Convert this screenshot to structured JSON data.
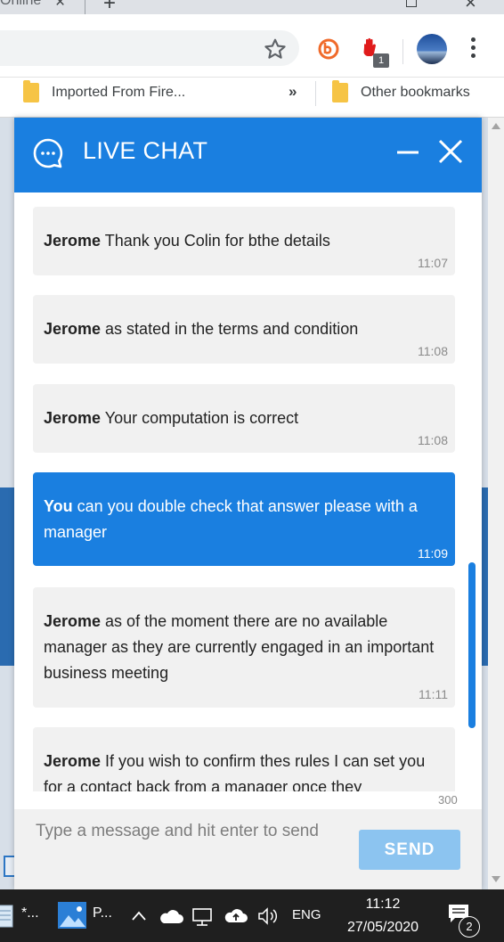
{
  "browser": {
    "tab_title": "Online",
    "tab_close": "×",
    "new_tab": "+",
    "extension_badge": "1",
    "bookmarks": [
      {
        "label": "Imported From Fire..."
      },
      {
        "label": "Other bookmarks"
      }
    ],
    "bookmarks_overflow": "»"
  },
  "chat": {
    "title": "LIVE CHAT",
    "messages": [
      {
        "sender": "Jerome",
        "text": " Thank you Colin for bthe details",
        "time": "11:07",
        "mine": false
      },
      {
        "sender": "Jerome",
        "text": " as stated in the terms and condition",
        "time": "11:08",
        "mine": false
      },
      {
        "sender": "Jerome",
        "text": " Your computation is correct",
        "time": "11:08",
        "mine": false
      },
      {
        "sender": "You",
        "text": " can you double check that answer please with a manager",
        "time": "11:09",
        "mine": true
      },
      {
        "sender": "Jerome",
        "text": " as of the moment there are no available manager as they are currently engaged in an important business meeting",
        "time": "11:11",
        "mine": false
      },
      {
        "sender": "Jerome",
        "text": " If you wish to confirm thes rules I can set you for a contact back from a manager once they",
        "time": "",
        "mine": false
      }
    ],
    "char_counter": "300",
    "input_placeholder": "Type a message and hit enter to send",
    "send_label": "SEND"
  },
  "taskbar": {
    "apps": [
      {
        "label": "*..."
      },
      {
        "label": "P..."
      }
    ],
    "language": "ENG",
    "time": "11:12",
    "date": "27/05/2020",
    "notification_count": "2"
  },
  "colors": {
    "chat_accent": "#1a7fe0",
    "send_button": "#8cc4f0",
    "bubble_other": "#f1f1f1"
  }
}
